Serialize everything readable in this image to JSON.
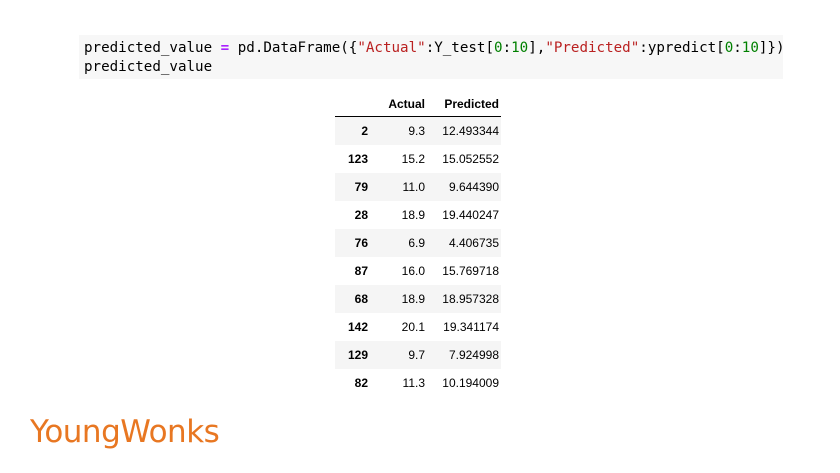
{
  "code_cell": {
    "line1": {
      "var": "predicted_value ",
      "op": "=",
      "mid1": " pd.DataFrame({",
      "str1": "\"Actual\"",
      "mid2": ":Y_test[",
      "n1": "0",
      "mid3": ":",
      "n2": "10",
      "mid4": "],",
      "str2": "\"Predicted\"",
      "mid5": ":ypredict[",
      "n3": "0",
      "mid6": ":",
      "n4": "10",
      "end": "]})"
    },
    "line2": "predicted_value"
  },
  "dataframe": {
    "columns": [
      "",
      "Actual",
      "Predicted"
    ],
    "rows": [
      {
        "index": "2",
        "actual": "9.3",
        "predicted": "12.493344"
      },
      {
        "index": "123",
        "actual": "15.2",
        "predicted": "15.052552"
      },
      {
        "index": "79",
        "actual": "11.0",
        "predicted": "9.644390"
      },
      {
        "index": "28",
        "actual": "18.9",
        "predicted": "19.440247"
      },
      {
        "index": "76",
        "actual": "6.9",
        "predicted": "4.406735"
      },
      {
        "index": "87",
        "actual": "16.0",
        "predicted": "15.769718"
      },
      {
        "index": "68",
        "actual": "18.9",
        "predicted": "18.957328"
      },
      {
        "index": "142",
        "actual": "20.1",
        "predicted": "19.341174"
      },
      {
        "index": "129",
        "actual": "9.7",
        "predicted": "7.924998"
      },
      {
        "index": "82",
        "actual": "11.3",
        "predicted": "10.194009"
      }
    ]
  },
  "logo": {
    "text": "YoungWonks",
    "color": "#e87722"
  },
  "colors": {
    "code_bg": "#f7f7f7",
    "string": "#ba2121",
    "number": "#008000",
    "operator": "#aa22ff"
  }
}
